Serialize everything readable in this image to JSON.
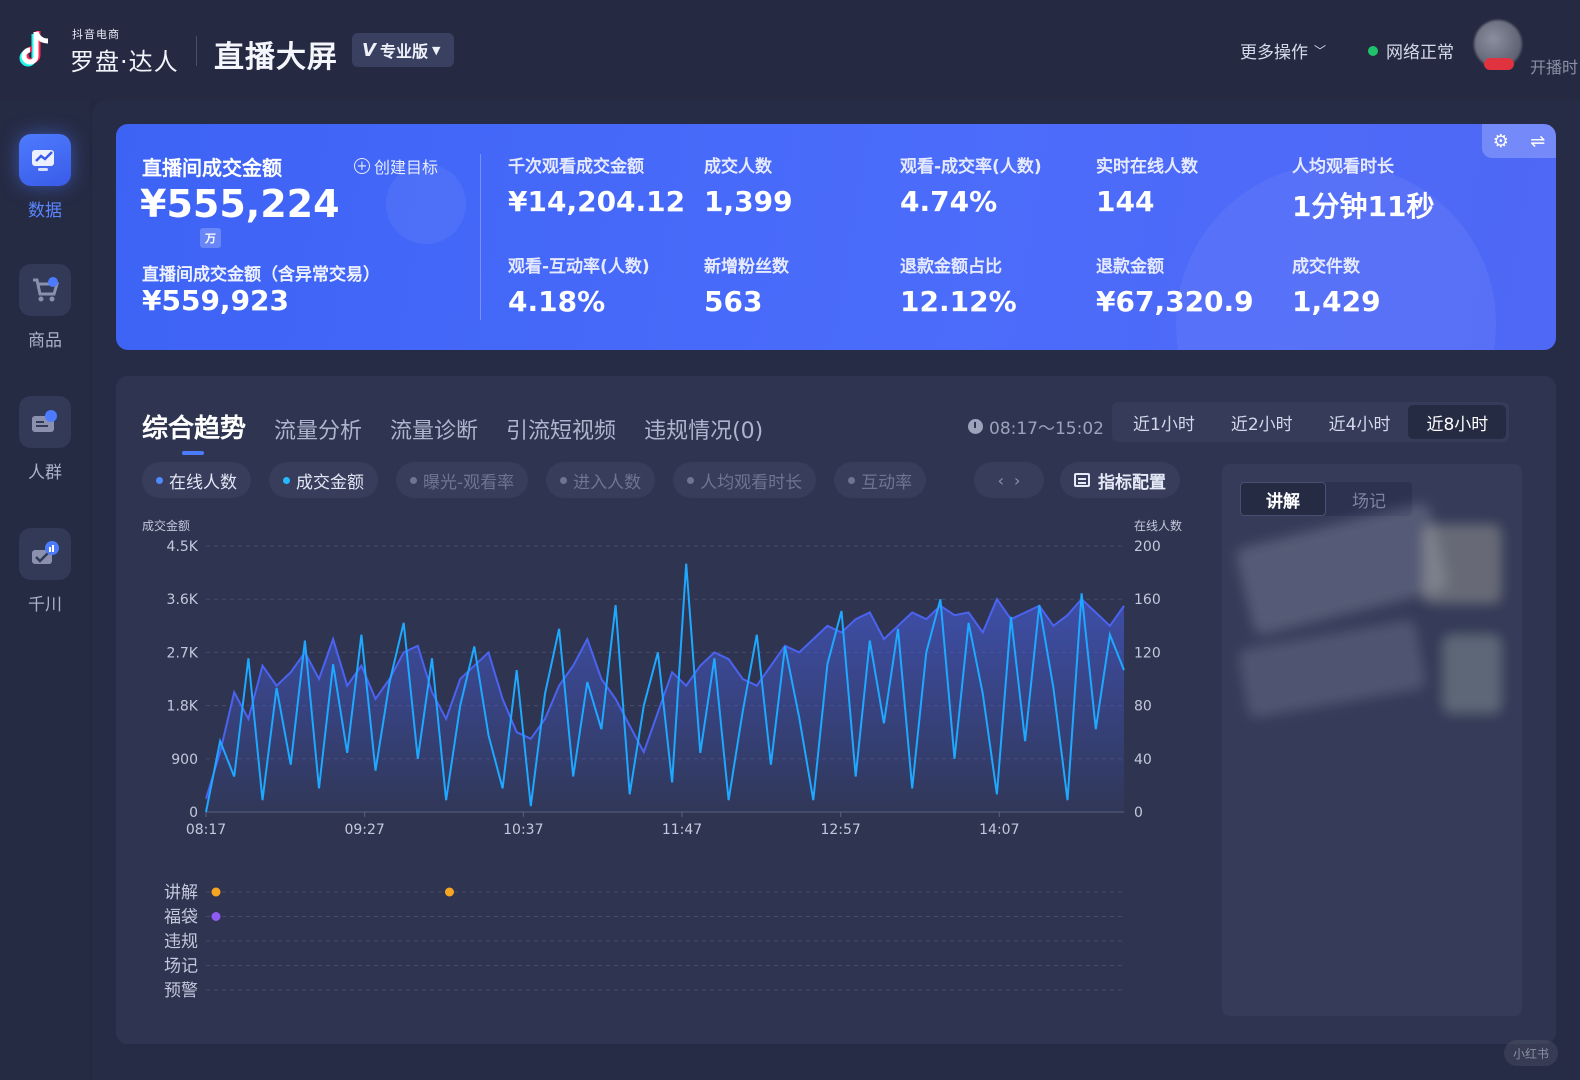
{
  "header": {
    "brand_small": "抖音电商",
    "brand_big": "罗盘·达人",
    "page_title": "直播大屏",
    "edition": "专业版",
    "more_ops": "更多操作",
    "network_status": "网络正常",
    "start_time_label": "开播时"
  },
  "sidenav": {
    "items": [
      {
        "label": "数据",
        "icon": "chart-up-icon",
        "active": true
      },
      {
        "label": "商品",
        "icon": "cart-icon",
        "active": false
      },
      {
        "label": "人群",
        "icon": "user-card-icon",
        "active": false
      },
      {
        "label": "千川",
        "icon": "signal-cart-icon",
        "active": false
      }
    ]
  },
  "kpi": {
    "main_label": "直播间成交金额",
    "create_target": "创建目标",
    "main_value": "¥555,224",
    "unit_badge": "万",
    "sub_label": "直播间成交金额（含异常交易）",
    "sub_value": "¥559,923",
    "cells": [
      {
        "label": "千次观看成交金额",
        "value": "¥14,204.12"
      },
      {
        "label": "成交人数",
        "value": "1,399"
      },
      {
        "label": "观看-成交率(人数)",
        "value": "4.74%"
      },
      {
        "label": "实时在线人数",
        "value": "144"
      },
      {
        "label": "人均观看时长",
        "value": "1分钟11秒"
      },
      {
        "label": "观看-互动率(人数)",
        "value": "4.18%"
      },
      {
        "label": "新增粉丝数",
        "value": "563"
      },
      {
        "label": "退款金额占比",
        "value": "12.12%"
      },
      {
        "label": "退款金额",
        "value": "¥67,320.9"
      },
      {
        "label": "成交件数",
        "value": "1,429"
      }
    ]
  },
  "trend": {
    "tabs": [
      "综合趋势",
      "流量分析",
      "流量诊断",
      "引流短视频",
      "违规情况(0)"
    ],
    "time_range": "08:17～15:02",
    "ranges": [
      "近1小时",
      "近2小时",
      "近4小时",
      "近8小时"
    ],
    "active_range": "近8小时",
    "chips": [
      {
        "label": "在线人数",
        "on": true
      },
      {
        "label": "成交金额",
        "on": true
      },
      {
        "label": "曝光-观看率",
        "on": false
      },
      {
        "label": "进入人数",
        "on": false
      },
      {
        "label": "人均观看时长",
        "on": false
      },
      {
        "label": "互动率",
        "on": false
      }
    ],
    "metric_config": "指标配置",
    "side_tabs": [
      "讲解",
      "场记"
    ],
    "event_rows": [
      "讲解",
      "福袋",
      "违规",
      "场记",
      "预警"
    ]
  },
  "chart_data": {
    "type": "line",
    "x": [
      "08:17",
      "09:27",
      "10:37",
      "11:47",
      "12:57",
      "14:07"
    ],
    "y_left": {
      "label": "成交金额",
      "ticks": [
        "0",
        "900",
        "1.8K",
        "2.7K",
        "3.6K",
        "4.5K"
      ],
      "ylim": [
        0,
        4500
      ]
    },
    "y_right": {
      "label": "在线人数",
      "ticks": [
        "0",
        "40",
        "80",
        "120",
        "160",
        "200"
      ],
      "ylim": [
        0,
        200
      ]
    },
    "series": [
      {
        "name": "在线人数",
        "axis": "right",
        "color": "#4a63f0",
        "values": [
          10,
          45,
          90,
          70,
          110,
          95,
          105,
          120,
          100,
          130,
          95,
          110,
          85,
          100,
          120,
          125,
          90,
          70,
          100,
          110,
          120,
          85,
          60,
          55,
          70,
          95,
          110,
          130,
          100,
          85,
          65,
          45,
          75,
          105,
          95,
          110,
          120,
          115,
          100,
          95,
          110,
          125,
          120,
          130,
          140,
          135,
          145,
          150,
          130,
          140,
          150,
          145,
          155,
          148,
          150,
          135,
          160,
          145,
          150,
          155,
          140,
          148,
          160,
          150,
          140,
          155
        ]
      },
      {
        "name": "成交金额",
        "axis": "left",
        "color": "#1fa8ff",
        "values": [
          0,
          1200,
          600,
          2600,
          200,
          2100,
          800,
          2900,
          400,
          2500,
          1000,
          3000,
          700,
          2200,
          3200,
          900,
          2600,
          200,
          1800,
          2800,
          1300,
          400,
          2400,
          100,
          2000,
          3100,
          600,
          2200,
          1400,
          3500,
          300,
          1800,
          2700,
          500,
          4200,
          1000,
          2600,
          200,
          1700,
          3000,
          800,
          2800,
          1600,
          200,
          2500,
          3400,
          600,
          2900,
          1500,
          3100,
          400,
          2700,
          3600,
          900,
          3200,
          2000,
          300,
          3300,
          1200,
          3500,
          2100,
          200,
          3700,
          1400,
          3000,
          2400
        ]
      }
    ],
    "events": {
      "讲解": [
        "08:17",
        "10:00"
      ],
      "福袋": [
        "08:17"
      ]
    },
    "grid": true
  },
  "watermark": "小红书"
}
